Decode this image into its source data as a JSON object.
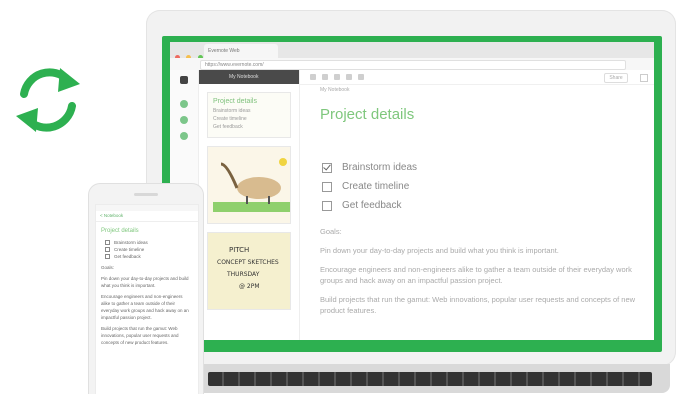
{
  "colors": {
    "accent": "#2db050",
    "title_green": "#7fc77d"
  },
  "sync_icon": "sync-arrows-icon",
  "browser": {
    "tab_title": "Evernote Web",
    "url": "https://www.evernote.com/"
  },
  "app": {
    "notebook_label": "My Notebook",
    "toolbar_right_label": "Share",
    "card": {
      "title": "Project details",
      "items": [
        "Brainstorm ideas",
        "Create timeline",
        "Get feedback"
      ]
    },
    "sketch_text": "PITCH\nCONCEPT SKETCHES\nTHURSDAY\n@ 2PM"
  },
  "editor": {
    "meta": "My Notebook",
    "title": "Project details",
    "checklist": [
      {
        "label": "Brainstorm ideas",
        "checked": true
      },
      {
        "label": "Create timeline",
        "checked": false
      },
      {
        "label": "Get feedback",
        "checked": false
      }
    ],
    "goals_label": "Goals:",
    "paragraphs": [
      "Pin down your day-to-day projects and build what you think is important.",
      "Encourage engineers and non-engineers alike to gather a team outside of their everyday work groups and hack away on an impactful passion project.",
      "Build projects that run the gamut: Web innovations, popular user requests and concepts of new product features."
    ]
  },
  "phone": {
    "nav_label": "< Notebook",
    "title": "Project details",
    "checklist": [
      "Brainstorm ideas",
      "Create timeline",
      "Get feedback"
    ],
    "goals_label": "Goals:",
    "paragraphs": [
      "Pin down your day-to-day projects and build what you think is important.",
      "Encourage engineers and non-engineers alike to gather a team outside of their everyday work groups and hack away on an impactful passion project.",
      "Build projects that run the gamut: Web innovations, popular user requests and concepts of new product features."
    ]
  }
}
